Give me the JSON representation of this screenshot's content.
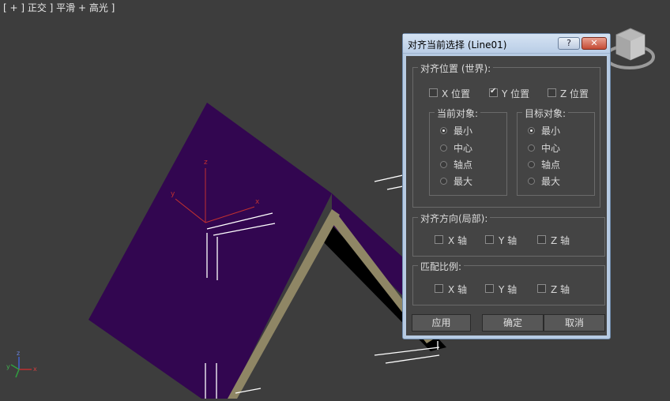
{
  "viewport": {
    "label": "[ + ] 正交 ] 平滑 + 高光 ]",
    "axis_labels": {
      "x": "x",
      "y": "y",
      "z": "z"
    },
    "colors": {
      "roof": "#320650",
      "trim": "#8f8665",
      "background": "#3d3d3d"
    }
  },
  "dialog": {
    "title": "对齐当前选择 (Line01)",
    "help_label": "?",
    "close_label": "✕",
    "align_position": {
      "legend": "对齐位置 (世界):",
      "x": {
        "label": "X 位置",
        "checked": false
      },
      "y": {
        "label": "Y 位置",
        "checked": true
      },
      "z": {
        "label": "Z 位置",
        "checked": false
      }
    },
    "current_object": {
      "legend": "当前对象:",
      "options": [
        "最小",
        "中心",
        "轴点",
        "最大"
      ],
      "selected": "最小"
    },
    "target_object": {
      "legend": "目标对象:",
      "options": [
        "最小",
        "中心",
        "轴点",
        "最大"
      ],
      "selected": "最小"
    },
    "align_orientation": {
      "legend": "对齐方向(局部):",
      "x": "X 轴",
      "y": "Y 轴",
      "z": "Z 轴"
    },
    "match_scale": {
      "legend": "匹配比例:",
      "x": "X 轴",
      "y": "Y 轴",
      "z": "Z 轴"
    },
    "buttons": {
      "apply": "应用",
      "ok": "确定",
      "cancel": "取消"
    }
  }
}
